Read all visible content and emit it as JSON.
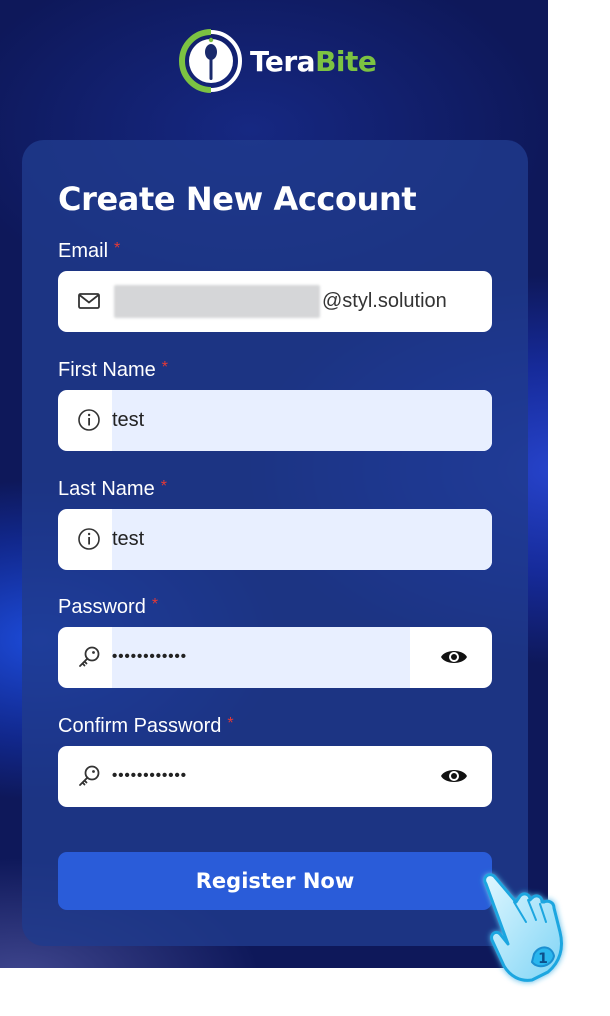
{
  "brand": {
    "name_part1": "Tera",
    "name_part2": "Bite",
    "accent_color": "#7cc242"
  },
  "form": {
    "title": "Create New Account",
    "required_marker": "*",
    "fields": {
      "email": {
        "label": "Email",
        "icon": "mail-icon",
        "value_domain": "@styl.solution",
        "local_part_redacted": true
      },
      "first_name": {
        "label": "First Name",
        "icon": "info-icon",
        "value": "test"
      },
      "last_name": {
        "label": "Last Name",
        "icon": "info-icon",
        "value": "test"
      },
      "password": {
        "label": "Password",
        "icon": "key-icon",
        "masked_value": "••••••••••••",
        "toggle_icon": "eye-icon"
      },
      "confirm_password": {
        "label": "Confirm Password",
        "icon": "key-icon",
        "masked_value": "••••••••••••",
        "toggle_icon": "eye-icon"
      }
    },
    "submit_label": "Register Now",
    "submit_color": "#2a5cd9"
  },
  "overlay": {
    "cursor_icon": "hand-pointer-icon",
    "click_count": "1"
  }
}
